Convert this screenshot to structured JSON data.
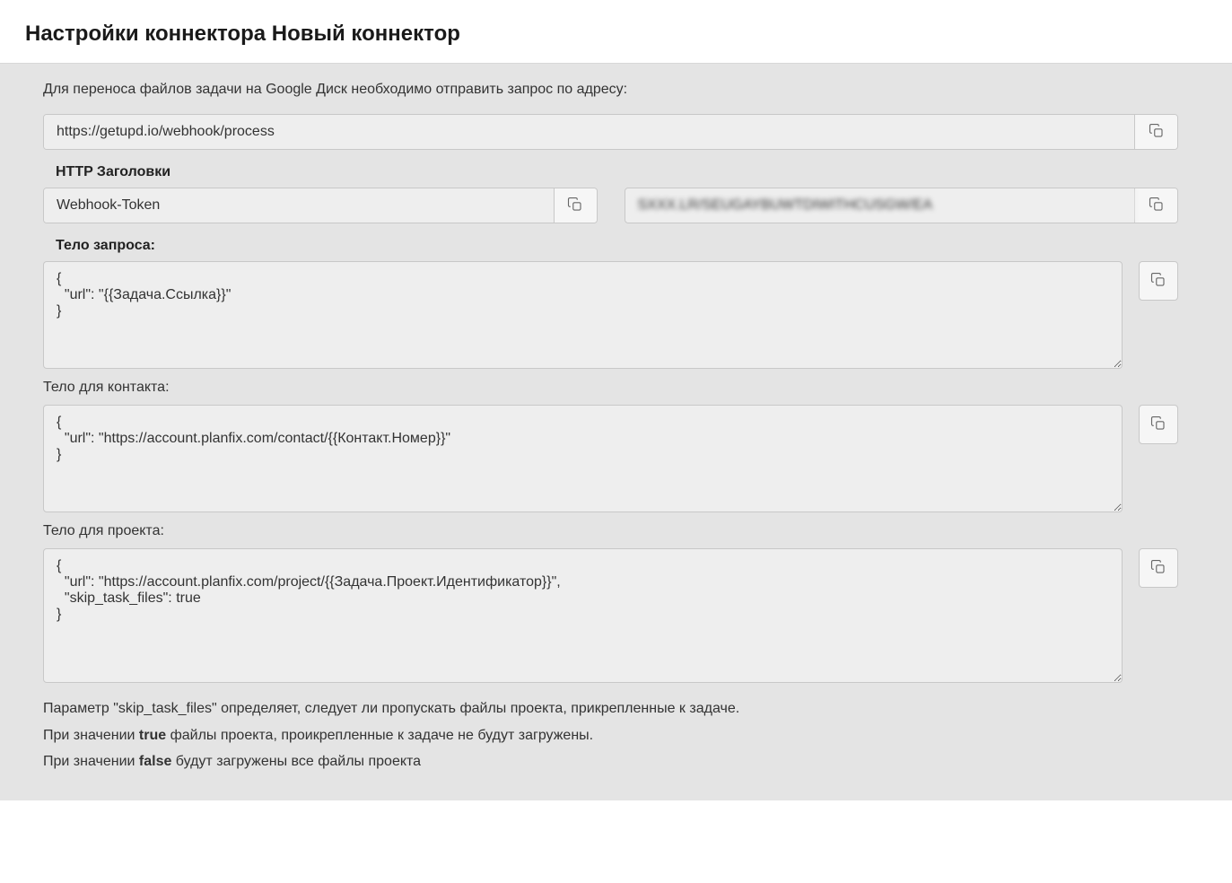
{
  "page_title": "Настройки коннектора Новый коннектор",
  "intro": "Для переноса файлов задачи на Google Диск необходимо отправить запрос по адресу:",
  "webhook_url": "https://getupd.io/webhook/process",
  "headers": {
    "title": "HTTP Заголовки",
    "name": "Webhook-Token",
    "value": "SXXX.LR/SEUGAYBUWTDIWITHCUSGW/EA"
  },
  "body": {
    "title": "Тело запроса:",
    "value": "{\n  \"url\": \"{{Задача.Ссылка}}\"\n}"
  },
  "contact_body": {
    "label": "Тело для контакта:",
    "value": "{\n  \"url\": \"https://account.planfix.com/contact/{{Контакт.Номер}}\"\n}"
  },
  "project_body": {
    "label": "Тело для проекта:",
    "value": "{\n  \"url\": \"https://account.planfix.com/project/{{Задача.Проект.Идентификатор}}\",\n  \"skip_task_files\": true\n}"
  },
  "footer": {
    "line1": "Параметр \"skip_task_files\" определяет, следует ли пропускать файлы проекта, прикрепленные к задаче.",
    "line2_pre": "При значении ",
    "line2_bold": "true",
    "line2_post": " файлы проекта, проикрепленные к задаче не будут загружены.",
    "line3_pre": "При значении ",
    "line3_bold": "false",
    "line3_post": " будут загружены все файлы проекта"
  }
}
